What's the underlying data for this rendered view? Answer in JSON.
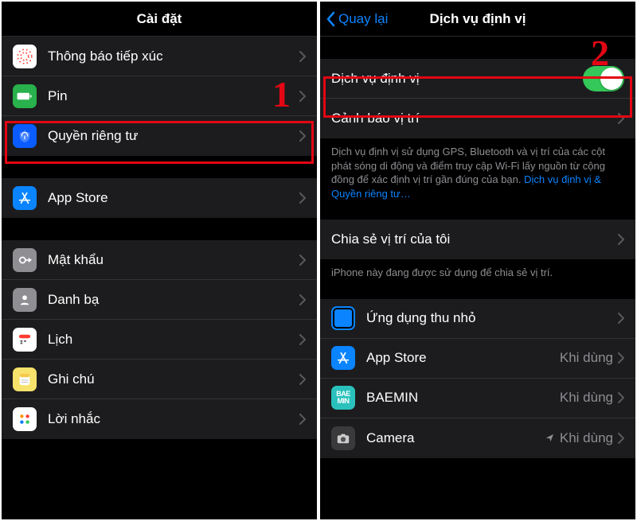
{
  "left": {
    "title": "Cài đặt",
    "step": "1",
    "rows": {
      "expo": "Thông báo tiếp xúc",
      "battery": "Pin",
      "privacy": "Quyền riêng tư",
      "appstore": "App Store",
      "passwords": "Mật khẩu",
      "contacts": "Danh bạ",
      "calendar": "Lịch",
      "notes": "Ghi chú",
      "reminders": "Lời nhắc"
    }
  },
  "right": {
    "back": "Quay lại",
    "title": "Dịch vụ định vị",
    "step": "2",
    "rows": {
      "locserv": "Dịch vụ định vị",
      "alerts": "Cảnh báo vị trí",
      "share": "Chia sẻ vị trí của tôi",
      "clips": "Ứng dụng thu nhỏ",
      "appstore": "App Store",
      "baemin": "BAEMIN",
      "camera": "Camera"
    },
    "values": {
      "appstore": "Khi dùng",
      "baemin": "Khi dùng",
      "camera": "Khi dùng"
    },
    "footer1a": "Dịch vụ định vị sử dụng GPS, Bluetooth và vị trí của các cột phát sóng di động và điểm truy cập Wi-Fi lấy nguồn từ cộng đồng để xác định vị trí gần đúng của bạn. ",
    "footer1b": "Dịch vụ định vị & Quyền riêng tư…",
    "footer2": "iPhone này đang được sử dụng để chia sẻ vị trí."
  }
}
